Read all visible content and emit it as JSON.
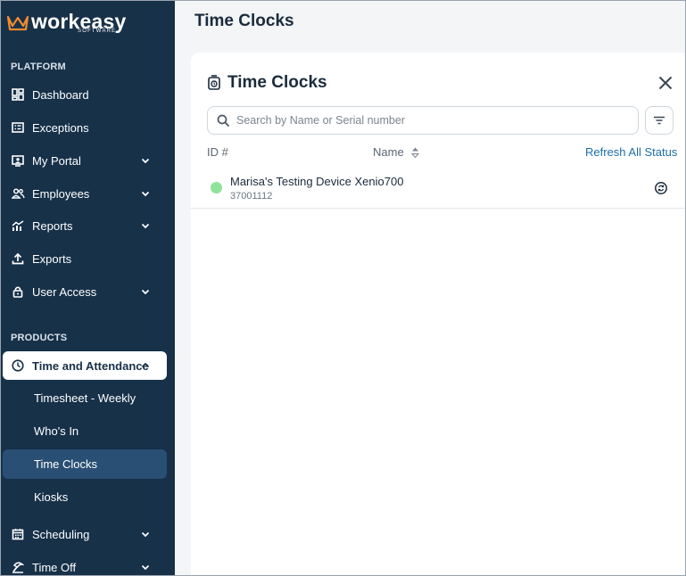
{
  "brand": {
    "name": "workeasy",
    "sub": "SOFTWARE",
    "accent": "#f08c2d"
  },
  "colors": {
    "sidebar_bg": "#173149",
    "status_online": "#8fe39a",
    "link": "#1b6fa8"
  },
  "sidebar": {
    "platform_title": "PLATFORM",
    "platform_items": [
      {
        "label": "Dashboard",
        "icon": "dashboard-icon"
      },
      {
        "label": "Exceptions",
        "icon": "exceptions-icon"
      },
      {
        "label": "My Portal",
        "icon": "portal-icon",
        "expandable": true
      },
      {
        "label": "Employees",
        "icon": "employees-icon",
        "expandable": true
      },
      {
        "label": "Reports",
        "icon": "reports-icon",
        "expandable": true
      },
      {
        "label": "Exports",
        "icon": "upload-icon"
      },
      {
        "label": "User Access",
        "icon": "lock-icon",
        "expandable": true
      }
    ],
    "products_title": "PRODUCTS",
    "time_attendance": {
      "label": "Time and Attendance",
      "icon": "clock-icon",
      "expanded": true
    },
    "sub_items": [
      {
        "label": "Timesheet - Weekly"
      },
      {
        "label": "Who's In"
      },
      {
        "label": "Time Clocks",
        "selected": true
      },
      {
        "label": "Kiosks"
      }
    ],
    "after_items": [
      {
        "label": "Scheduling",
        "icon": "calendar-icon",
        "expandable": true
      },
      {
        "label": "Time Off",
        "icon": "time-off-icon",
        "expandable": true
      }
    ]
  },
  "main": {
    "page_title": "Time Clocks",
    "card": {
      "title": "Time Clocks",
      "search_placeholder": "Search by Name or Serial number",
      "search_value": "",
      "columns": {
        "id": "ID #",
        "name": "Name"
      },
      "refresh_all": "Refresh All Status",
      "rows": [
        {
          "name": "Marisa's Testing Device Xenio700",
          "serial": "37001112",
          "status": "online"
        }
      ]
    }
  }
}
